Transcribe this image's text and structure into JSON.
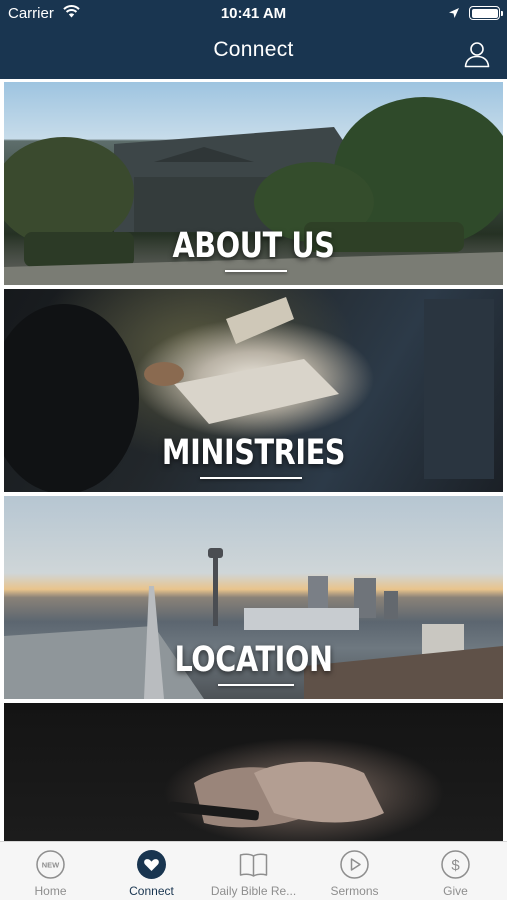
{
  "status_bar": {
    "carrier": "Carrier",
    "time": "10:41 AM"
  },
  "header": {
    "title": "Connect"
  },
  "tiles": [
    {
      "label": "ABOUT US"
    },
    {
      "label": "MINISTRIES"
    },
    {
      "label": "LOCATION"
    },
    {
      "label": ""
    }
  ],
  "tab_bar": {
    "items": [
      {
        "label": "Home",
        "icon": "new-badge-icon",
        "active": false,
        "badge_text": "NEW"
      },
      {
        "label": "Connect",
        "icon": "heart-icon",
        "active": true
      },
      {
        "label": "Daily Bible Re...",
        "icon": "open-book-icon",
        "active": false
      },
      {
        "label": "Sermons",
        "icon": "play-circle-icon",
        "active": false
      },
      {
        "label": "Give",
        "icon": "dollar-circle-icon",
        "active": false
      }
    ]
  },
  "colors": {
    "header_bg": "#193550",
    "accent": "#193550",
    "tab_inactive": "#8e8e8e",
    "tab_bar_bg": "#f6f6f6"
  }
}
